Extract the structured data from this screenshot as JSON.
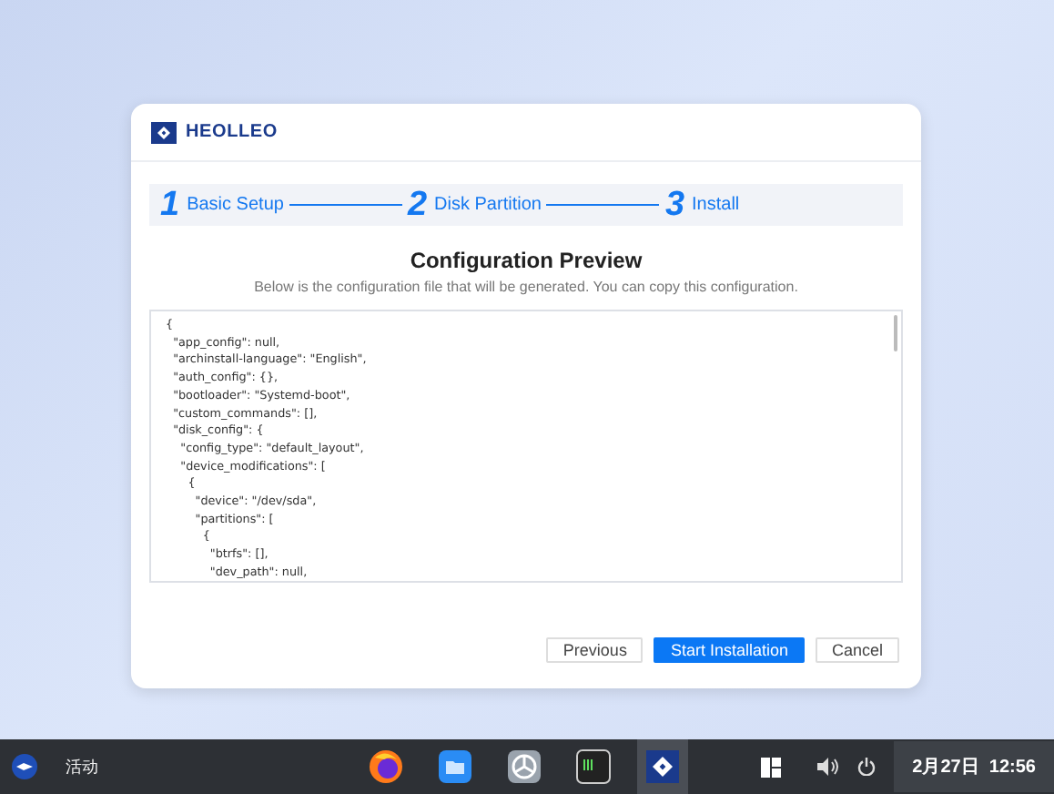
{
  "app": {
    "logo_text": "HEOLLEO"
  },
  "steps": [
    {
      "number": "1",
      "label": "Basic Setup"
    },
    {
      "number": "2",
      "label": "Disk Partition"
    },
    {
      "number": "3",
      "label": "Install"
    }
  ],
  "preview": {
    "title": "Configuration Preview",
    "subtitle": "Below is the configuration file that will be generated. You can copy this configuration.",
    "config_lines": [
      "{",
      "  \"app_config\": null,",
      "  \"archinstall-language\": \"English\",",
      "  \"auth_config\": {},",
      "  \"bootloader\": \"Systemd-boot\",",
      "  \"custom_commands\": [],",
      "  \"disk_config\": {",
      "    \"config_type\": \"default_layout\",",
      "    \"device_modifications\": [",
      "      {",
      "        \"device\": \"/dev/sda\",",
      "        \"partitions\": [",
      "          {",
      "            \"btrfs\": [],",
      "            \"dev_path\": null,"
    ]
  },
  "buttons": [
    {
      "label": "Previous",
      "kind": "secondary"
    },
    {
      "label": "Start Installation",
      "kind": "primary"
    },
    {
      "label": "Cancel",
      "kind": "secondary"
    }
  ],
  "taskbar": {
    "activities": "活动",
    "apps": [
      {
        "kind": "browser",
        "selected": false
      },
      {
        "kind": "files",
        "selected": false
      },
      {
        "kind": "settings",
        "selected": false
      },
      {
        "kind": "terminal",
        "selected": false
      },
      {
        "kind": "installer",
        "selected": true
      }
    ],
    "clock": "2月27日  12:56"
  }
}
